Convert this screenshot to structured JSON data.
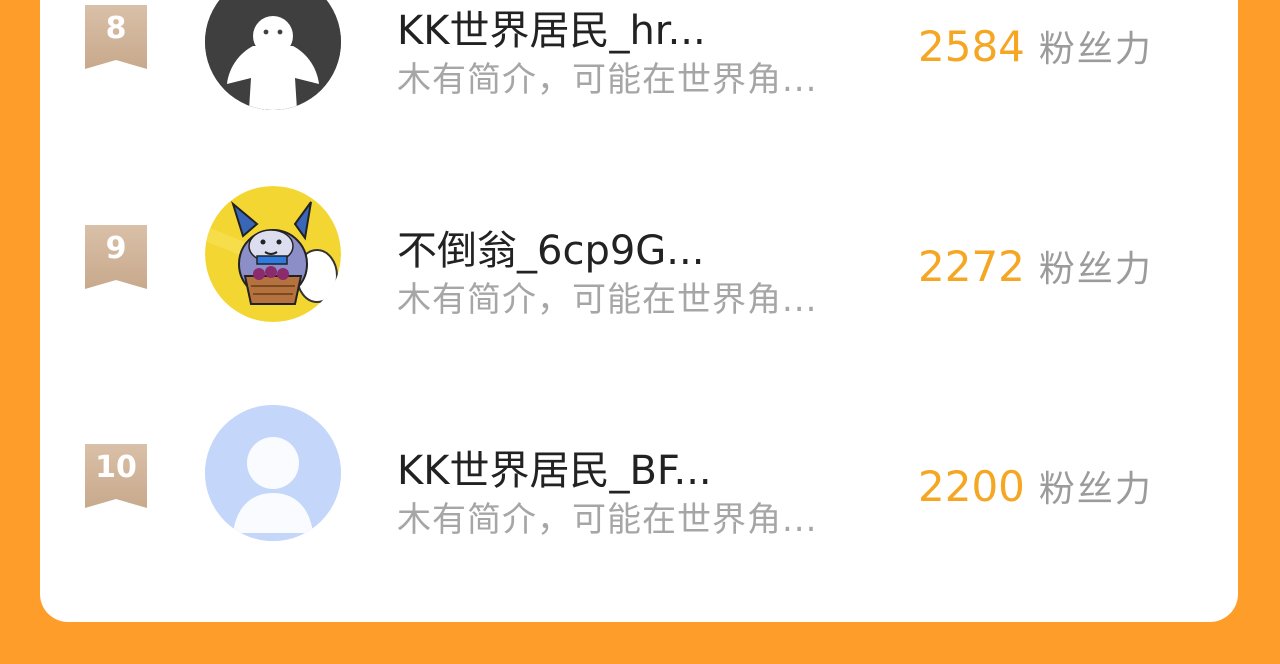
{
  "colors": {
    "page_background": "#FF9D2A",
    "card_background": "#FFFFFF",
    "fans_number": "#F5A623",
    "rank_badge": "#D3B89E"
  },
  "fans_label": "粉丝力",
  "rows": [
    {
      "rank": "8",
      "name": "KK世界居民_hr...",
      "bio": "木有简介，可能在世界角...",
      "fans": "2584",
      "avatar_icon": "white-ghost-avatar-icon"
    },
    {
      "rank": "9",
      "name": "不倒翁_6cp9G...",
      "bio": "木有简介，可能在世界角...",
      "fans": "2272",
      "avatar_icon": "cartoon-creature-avatar-icon"
    },
    {
      "rank": "10",
      "name": "KK世界居民_BF...",
      "bio": "木有简介，可能在世界角...",
      "fans": "2200",
      "avatar_icon": "default-person-avatar-icon"
    }
  ]
}
